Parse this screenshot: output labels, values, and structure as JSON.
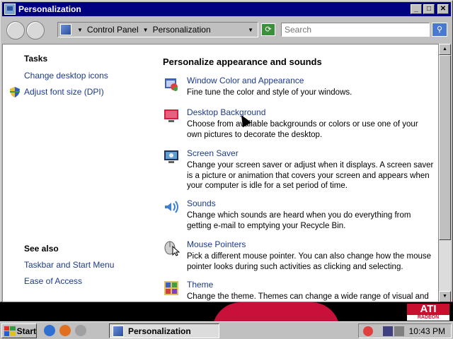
{
  "window": {
    "title": "Personalization",
    "min_glyph": "_",
    "max_glyph": "□",
    "close_glyph": "✕"
  },
  "address": {
    "crumbs": [
      "Control Panel",
      "Personalization"
    ],
    "search_placeholder": "Search"
  },
  "tasks": {
    "heading": "Tasks",
    "links": [
      "Change desktop icons",
      "Adjust font size (DPI)"
    ]
  },
  "see_also": {
    "heading": "See also",
    "links": [
      "Taskbar and Start Menu",
      "Ease of Access"
    ]
  },
  "main": {
    "heading": "Personalize appearance and sounds",
    "items": [
      {
        "title": "Window Color and Appearance",
        "desc": "Fine tune the color and style of your windows.",
        "icon": "window-color-icon"
      },
      {
        "title": "Desktop Background",
        "desc": "Choose from available backgrounds or colors or use one of your own pictures to decorate the desktop.",
        "icon": "desktop-background-icon"
      },
      {
        "title": "Screen Saver",
        "desc": "Change your screen saver or adjust when it displays. A screen saver is a picture or animation that covers your screen and appears when your computer is idle for a set period of time.",
        "icon": "screen-saver-icon"
      },
      {
        "title": "Sounds",
        "desc": "Change which sounds are heard when you do everything from getting e-mail to emptying your Recycle Bin.",
        "icon": "sounds-icon"
      },
      {
        "title": "Mouse Pointers",
        "desc": "Pick a different mouse pointer. You can also change how the mouse pointer looks during such activities as clicking and selecting.",
        "icon": "mouse-pointers-icon"
      },
      {
        "title": "Theme",
        "desc": "Change the theme. Themes can change a wide range of visual and",
        "icon": "theme-icon"
      }
    ]
  },
  "taskbar": {
    "start_label": "Start",
    "task_label": "Personalization",
    "clock": "10:43 PM"
  },
  "desktop": {
    "logo_text": "ATI",
    "logo_sub": "RADEON"
  }
}
